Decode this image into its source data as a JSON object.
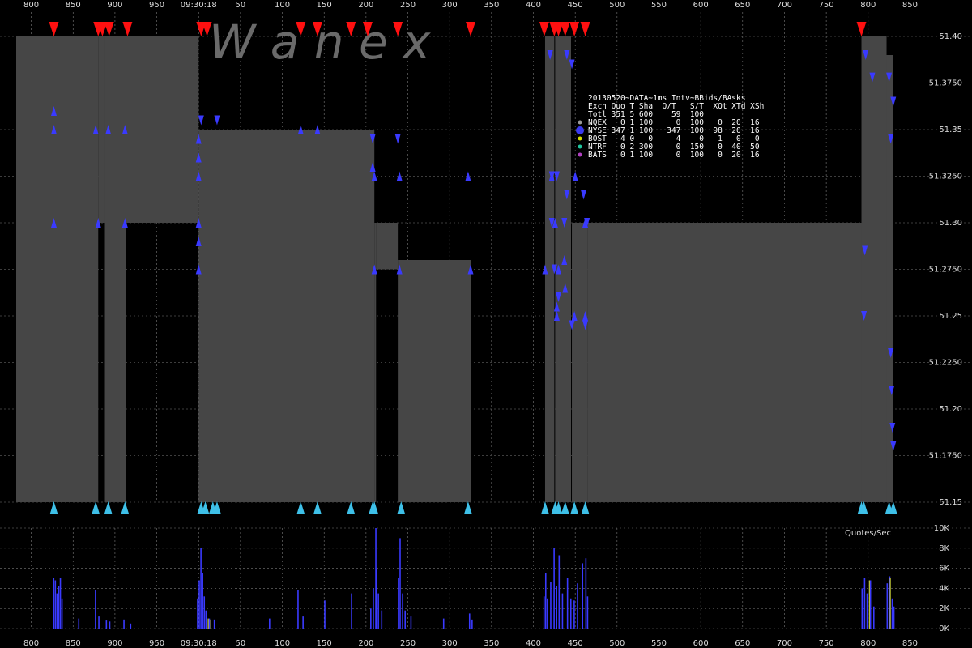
{
  "chart_data": {
    "type": "bar",
    "title": "20130520~DATA~1ms Intv~BBids/BAsks",
    "time_label": "09:30:18",
    "x_ticks": [
      {
        "v": 800,
        "label": "800"
      },
      {
        "v": 850,
        "label": "850"
      },
      {
        "v": 900,
        "label": "900"
      },
      {
        "v": 950,
        "label": "950"
      },
      {
        "v": 1000,
        "label": "09:30:18"
      },
      {
        "v": 1050,
        "label": "50"
      },
      {
        "v": 1100,
        "label": "100"
      },
      {
        "v": 1150,
        "label": "150"
      },
      {
        "v": 1200,
        "label": "200"
      },
      {
        "v": 1250,
        "label": "250"
      },
      {
        "v": 1300,
        "label": "300"
      },
      {
        "v": 1350,
        "label": "350"
      },
      {
        "v": 1400,
        "label": "400"
      },
      {
        "v": 1450,
        "label": "450"
      },
      {
        "v": 1500,
        "label": "500"
      },
      {
        "v": 1550,
        "label": "550"
      },
      {
        "v": 1600,
        "label": "600"
      },
      {
        "v": 1650,
        "label": "650"
      },
      {
        "v": 1700,
        "label": "700"
      },
      {
        "v": 1750,
        "label": "750"
      },
      {
        "v": 1800,
        "label": "800"
      },
      {
        "v": 1850,
        "label": "850"
      }
    ],
    "xlim": [
      782,
      1897
    ],
    "price_axis": {
      "ylim": [
        51.15,
        51.4
      ],
      "ticks": [
        "51.15",
        "51.1750",
        "51.20",
        "51.2250",
        "51.25",
        "51.2750",
        "51.30",
        "51.3250",
        "51.35",
        "51.3750",
        "51.40"
      ]
    },
    "rate_axis": {
      "label": "Quotes/Sec",
      "ylim": [
        0,
        10000
      ],
      "ticks": [
        {
          "v": 0,
          "label": "0K"
        },
        {
          "v": 2000,
          "label": "2K"
        },
        {
          "v": 4000,
          "label": "4K"
        },
        {
          "v": 6000,
          "label": "6K"
        },
        {
          "v": 8000,
          "label": "8K"
        },
        {
          "v": 10000,
          "label": "10K"
        }
      ]
    },
    "spread_segments": [
      [
        782,
        880,
        51.15,
        51.4
      ],
      [
        880,
        888,
        51.3,
        51.4
      ],
      [
        888,
        913,
        51.15,
        51.4
      ],
      [
        913,
        1000,
        51.3,
        51.4
      ],
      [
        1000,
        1210,
        51.15,
        51.35
      ],
      [
        1210,
        1212,
        51.15,
        51.3
      ],
      [
        1212,
        1238,
        51.275,
        51.3
      ],
      [
        1238,
        1325,
        51.15,
        51.28
      ],
      [
        1414,
        1425,
        51.15,
        51.4
      ],
      [
        1426,
        1445,
        51.15,
        51.4
      ],
      [
        1446,
        1465,
        51.15,
        51.3
      ],
      [
        1465,
        1792,
        51.15,
        51.3
      ],
      [
        1792,
        1822,
        51.15,
        51.4
      ],
      [
        1822,
        1830,
        51.15,
        51.39
      ]
    ],
    "spread_tops": [
      [
        782,
        1003,
        51.4
      ],
      [
        1003,
        1122,
        51.35
      ],
      [
        1122,
        1210,
        51.4
      ],
      [
        1212,
        1238,
        51.275
      ],
      [
        1238,
        1325,
        51.4
      ]
    ],
    "spread_bottoms": [
      [
        1212,
        1238,
        51.268
      ],
      [
        1238,
        1325,
        51.15
      ]
    ],
    "nbbo_ask_markers": [
      827,
      880,
      885,
      893,
      915,
      1003,
      1010,
      1122,
      1142,
      1182,
      1202,
      1238,
      1325,
      1413,
      1425,
      1430,
      1438,
      1449,
      1462,
      1792
    ],
    "nbbo_bid_markers": [
      827,
      877,
      892,
      912,
      1003,
      1008,
      1017,
      1022,
      1122,
      1142,
      1182,
      1208,
      1210,
      1242,
      1322,
      1414,
      1426,
      1430,
      1438,
      1449,
      1462,
      1792,
      1795,
      1825,
      1830
    ],
    "nyse_ask_quotes": [
      [
        1420,
        51.39
      ],
      [
        1440,
        51.39
      ],
      [
        1446,
        51.385
      ],
      [
        1797,
        51.39
      ],
      [
        1805,
        51.378
      ],
      [
        1825,
        51.378
      ],
      [
        1830,
        51.365
      ],
      [
        1827,
        51.345
      ],
      [
        1003,
        51.355
      ],
      [
        1022,
        51.355
      ],
      [
        1208,
        51.345
      ],
      [
        1238,
        51.345
      ],
      [
        1422,
        51.325
      ],
      [
        1428,
        51.325
      ],
      [
        1440,
        51.315
      ],
      [
        1460,
        51.315
      ],
      [
        1464,
        51.3
      ],
      [
        1437,
        51.3
      ],
      [
        1422,
        51.3
      ],
      [
        1796,
        51.285
      ],
      [
        1795,
        51.25
      ],
      [
        1827,
        51.23
      ],
      [
        1828,
        51.21
      ],
      [
        1830,
        51.18
      ],
      [
        1829,
        51.19
      ],
      [
        1425,
        51.275
      ],
      [
        1430,
        51.26
      ],
      [
        1446,
        51.245
      ],
      [
        1462,
        51.245
      ]
    ],
    "nyse_bid_quotes": [
      [
        827,
        51.36
      ],
      [
        827,
        51.35
      ],
      [
        877,
        51.35
      ],
      [
        892,
        51.35
      ],
      [
        912,
        51.35
      ],
      [
        1000,
        51.345
      ],
      [
        1000,
        51.335
      ],
      [
        1000,
        51.325
      ],
      [
        1122,
        51.35
      ],
      [
        1142,
        51.35
      ],
      [
        1208,
        51.33
      ],
      [
        1210,
        51.325
      ],
      [
        1240,
        51.325
      ],
      [
        1322,
        51.325
      ],
      [
        1422,
        51.325
      ],
      [
        1450,
        51.325
      ],
      [
        1462,
        51.3
      ],
      [
        1426,
        51.3
      ],
      [
        827,
        51.3
      ],
      [
        880,
        51.3
      ],
      [
        912,
        51.3
      ],
      [
        1000,
        51.3
      ],
      [
        1000,
        51.29
      ],
      [
        1000,
        51.275
      ],
      [
        1210,
        51.275
      ],
      [
        1240,
        51.275
      ],
      [
        1325,
        51.275
      ],
      [
        1414,
        51.275
      ],
      [
        1430,
        51.275
      ],
      [
        1437,
        51.28
      ],
      [
        1438,
        51.265
      ],
      [
        1428,
        51.255
      ],
      [
        1428,
        51.25
      ],
      [
        1462,
        51.25
      ],
      [
        1449,
        51.25
      ]
    ],
    "quote_rate_bars": [
      [
        826,
        5000
      ],
      [
        828,
        4800
      ],
      [
        830,
        3500
      ],
      [
        832,
        4200
      ],
      [
        834,
        5000
      ],
      [
        836,
        3000
      ],
      [
        856,
        1000
      ],
      [
        876,
        3800
      ],
      [
        880,
        1200
      ],
      [
        889,
        800
      ],
      [
        893,
        700
      ],
      [
        910,
        900
      ],
      [
        918,
        500
      ],
      [
        998,
        3000
      ],
      [
        1000,
        4800
      ],
      [
        1002,
        8000
      ],
      [
        1004,
        5500
      ],
      [
        1006,
        3200
      ],
      [
        1008,
        1800
      ],
      [
        1012,
        1000
      ],
      [
        1018,
        900
      ],
      [
        1084,
        1000
      ],
      [
        1118,
        3800
      ],
      [
        1124,
        1200
      ],
      [
        1150,
        2800
      ],
      [
        1182,
        3500
      ],
      [
        1205,
        2000
      ],
      [
        1208,
        4000
      ],
      [
        1211,
        10000
      ],
      [
        1212,
        6000
      ],
      [
        1214,
        3500
      ],
      [
        1218,
        1800
      ],
      [
        1238,
        5000
      ],
      [
        1240,
        9000
      ],
      [
        1243,
        3500
      ],
      [
        1246,
        1800
      ],
      [
        1253,
        1200
      ],
      [
        1292,
        1000
      ],
      [
        1323,
        1500
      ],
      [
        1326,
        900
      ],
      [
        1412,
        3200
      ],
      [
        1414,
        5500
      ],
      [
        1416,
        3000
      ],
      [
        1420,
        4600
      ],
      [
        1424,
        8000
      ],
      [
        1427,
        4200
      ],
      [
        1430,
        7300
      ],
      [
        1434,
        3500
      ],
      [
        1440,
        5000
      ],
      [
        1444,
        3000
      ],
      [
        1448,
        2800
      ],
      [
        1452,
        4500
      ],
      [
        1458,
        6500
      ],
      [
        1462,
        7000
      ],
      [
        1464,
        3200
      ],
      [
        1792,
        4000
      ],
      [
        1795,
        5000
      ],
      [
        1798,
        3500
      ],
      [
        1802,
        4800
      ],
      [
        1806,
        2200
      ],
      [
        1822,
        4500
      ],
      [
        1825,
        5200
      ],
      [
        1828,
        3000
      ],
      [
        1830,
        2200
      ]
    ],
    "quote_rate_bars_yellow": [
      [
        1010,
        1000
      ],
      [
        1013,
        900
      ],
      [
        1800,
        4800
      ],
      [
        1825,
        5000
      ]
    ],
    "watermark": "W   a   n   e   x"
  },
  "legend": {
    "header_line": "Exch Quo T Sha  Q/T   S/T  XQt XTd XSh",
    "rows": [
      {
        "dot": "#9a9a9a",
        "text": "Totl 351 5 600    59  100",
        "dot_visible": false
      },
      {
        "dot": "#9a9a9a",
        "text": "NQEX   0 1 100     0  100   0  20  16",
        "dot_visible": true
      },
      {
        "dot": "#3a3af0",
        "text": "NYSE 347 1 100   347  100  98  20  16",
        "dot_visible": true
      },
      {
        "dot": "#d8e000",
        "text": "BOST   4 0   0     4    0   1   0   0",
        "dot_visible": true
      },
      {
        "dot": "#20c8a0",
        "text": "NTRF   0 2 300     0  150   0  40  50",
        "dot_visible": true
      },
      {
        "dot": "#b040c0",
        "text": "BATS   0 1 100     0  100   0  20  16",
        "dot_visible": true
      }
    ]
  },
  "colors": {
    "spread": "#464646",
    "ask_red": "#ff1010",
    "bid_cyan": "#3ec0e8",
    "nyse_blue": "#3a3aff",
    "yellow": "#e8f040",
    "grid": "#7a7a7a"
  }
}
